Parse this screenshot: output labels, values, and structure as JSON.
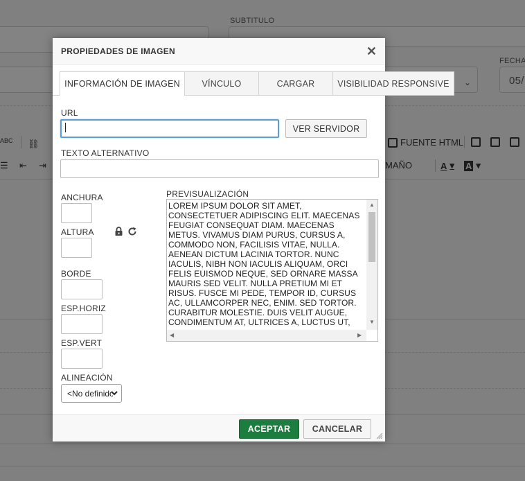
{
  "background": {
    "label_subtitulo": "SUBTITULO",
    "label_fecha": "FECHA",
    "fecha_value": "05/",
    "toolbar_spell": "ABC",
    "toolbar_source": "FUENTE HTML",
    "toolbar_size": "MAÑO",
    "toolbar_text_color": "A",
    "toolbar_bg_color": "A"
  },
  "dialog": {
    "title": "PROPIEDADES DE IMAGEN",
    "close_glyph": "✕",
    "tabs": [
      {
        "label": "INFORMACIÓN DE IMAGEN",
        "active": true
      },
      {
        "label": "VÍNCULO",
        "active": false
      },
      {
        "label": "CARGAR",
        "active": false
      },
      {
        "label": "VISIBILIDAD RESPONSIVE",
        "active": false
      }
    ],
    "url_label": "URL",
    "url_value": "",
    "browse_server_label": "VER SERVIDOR",
    "alt_text_label": "TEXTO ALTERNATIVO",
    "alt_text_value": "",
    "width_label": "ANCHURA",
    "height_label": "ALTURA",
    "border_label": "BORDE",
    "hspace_label": "ESP.HORIZ",
    "vspace_label": "ESP.VERT",
    "align_label": "ALINEACIÓN",
    "align_selected": "<No definido>",
    "preview_label": "PREVISUALIZACIÓN",
    "preview_text": "LOREM IPSUM DOLOR SIT AMET, CONSECTETUER ADIPISCING ELIT. MAECENAS FEUGIAT CONSEQUAT DIAM. MAECENAS METUS. VIVAMUS DIAM PURUS, CURSUS A, COMMODO NON, FACILISIS VITAE, NULLA. AENEAN DICTUM LACINIA TORTOR. NUNC IACULIS, NIBH NON IACULIS ALIQUAM, ORCI FELIS EUISMOD NEQUE, SED ORNARE MASSA MAURIS SED VELIT. NULLA PRETIUM MI ET RISUS. FUSCE MI PEDE, TEMPOR ID, CURSUS AC, ULLAMCORPER NEC, ENIM. SED TORTOR. CURABITUR MOLESTIE. DUIS VELIT AUGUE, CONDIMENTUM AT, ULTRICES A, LUCTUS UT, ORCI. DONEC PELLENTESQUE EGESTAS",
    "ok_label": "ACEPTAR",
    "cancel_label": "CANCELAR"
  },
  "colors": {
    "accent_green": "#1b7e3f",
    "focus_blue": "#5d9fd3",
    "overlay_gray": "#808080"
  }
}
